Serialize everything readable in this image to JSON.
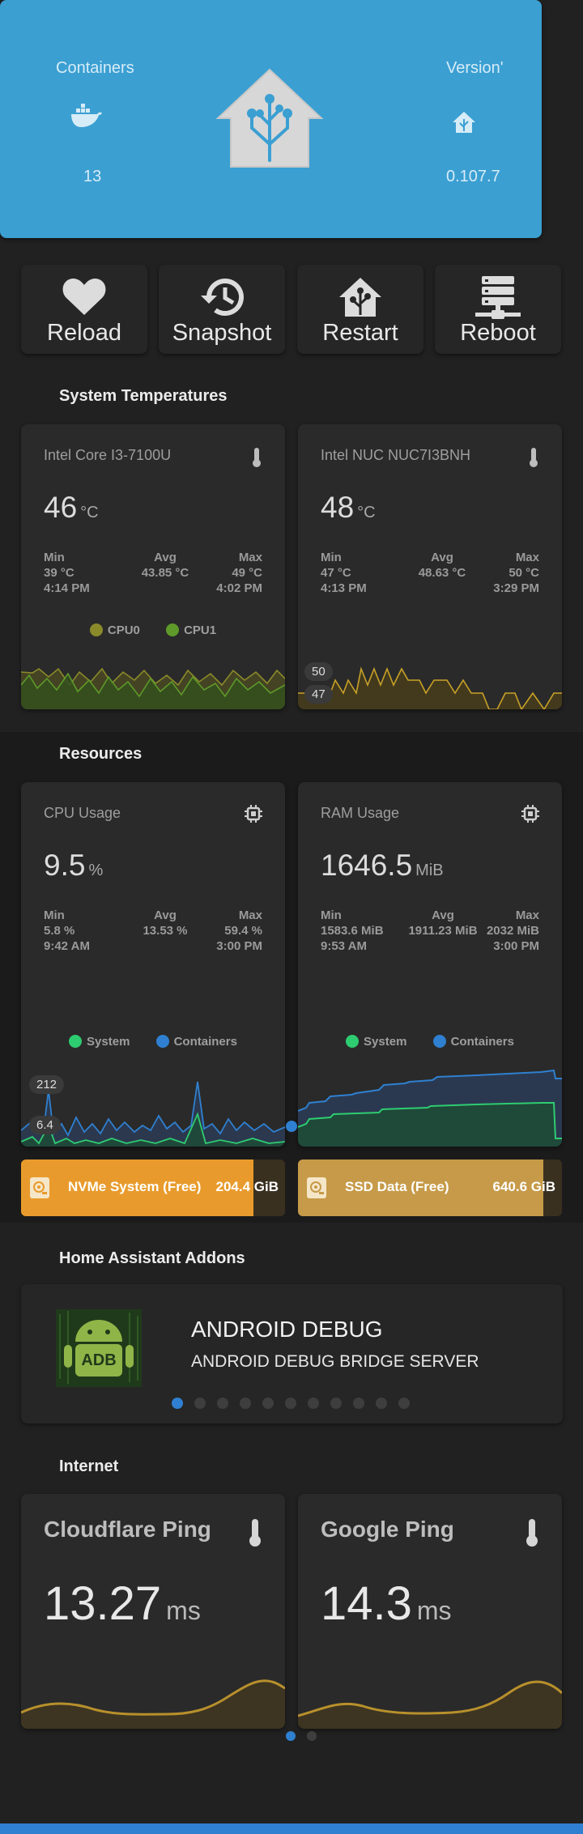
{
  "hero": {
    "containers_label": "Containers",
    "containers_value": "13",
    "version_label": "Version'",
    "version_value": "0.107.7",
    "hero_color": "#3b9fd2"
  },
  "buttons": [
    {
      "label": "Reload",
      "icon": "heart-icon"
    },
    {
      "label": "Snapshot",
      "icon": "restore-icon"
    },
    {
      "label": "Restart",
      "icon": "home-assistant-icon"
    },
    {
      "label": "Reboot",
      "icon": "server-network-icon"
    }
  ],
  "sections": {
    "temps": "System Temperatures",
    "resources": "Resources",
    "addons": "Home Assistant Addons",
    "internet": "Internet"
  },
  "temp_cards": [
    {
      "name": "Intel Core I3-7100U",
      "value": "46",
      "unit": "°C",
      "min_label": "Min",
      "avg_label": "Avg",
      "max_label": "Max",
      "min": "39 °C",
      "avg": "43.85 °C",
      "max": "49 °C",
      "min_time": "4:14 PM",
      "max_time": "4:02 PM",
      "legend": [
        "CPU0",
        "CPU1"
      ]
    },
    {
      "name": "Intel NUC NUC7I3BNH",
      "value": "48",
      "unit": "°C",
      "min_label": "Min",
      "avg_label": "Avg",
      "max_label": "Max",
      "min": "47 °C",
      "avg": "48.63 °C",
      "max": "50 °C",
      "min_time": "4:13 PM",
      "max_time": "3:29 PM",
      "chip_high": "50",
      "chip_low": "47"
    }
  ],
  "resource_cards": [
    {
      "name": "CPU Usage",
      "value": "9.5",
      "unit": "%",
      "min_label": "Min",
      "avg_label": "Avg",
      "max_label": "Max",
      "min": "5.8 %",
      "avg": "13.53 %",
      "max": "59.4 %",
      "min_time": "9:42 AM",
      "max_time": "3:00 PM",
      "legend": [
        "System",
        "Containers"
      ],
      "chip_high": "212",
      "chip_low": "6.4"
    },
    {
      "name": "RAM Usage",
      "value": "1646.5",
      "unit": "MiB",
      "min_label": "Min",
      "avg_label": "Avg",
      "max_label": "Max",
      "min": "1583.6 MiB",
      "avg": "1911.23 MiB",
      "max": "2032 MiB",
      "min_time": "9:53 AM",
      "max_time": "3:00 PM",
      "legend": [
        "System",
        "Containers"
      ]
    }
  ],
  "storage": [
    {
      "name": "NVMe System (Free)",
      "value": "204.4 GiB",
      "fill": 0.88,
      "color": "#e89b2c"
    },
    {
      "name": "SSD Data (Free)",
      "value": "640.6 GiB",
      "fill": 0.93,
      "color": "#c69a48"
    }
  ],
  "addon": {
    "title": "ANDROID DEBUG",
    "subtitle": "ANDROID DEBUG BRIDGE SERVER",
    "logo_text": "ADB",
    "page_count": 11,
    "active_page": 0
  },
  "ping_cards": [
    {
      "name": "Cloudflare Ping",
      "value": "13.27",
      "unit": "ms"
    },
    {
      "name": "Google Ping",
      "value": "14.3",
      "unit": "ms"
    }
  ],
  "ping_pages": {
    "count": 2,
    "active": 0
  },
  "colors": {
    "cpu0": "#8a8a2a",
    "cpu1": "#5e9a2a",
    "nuc_line": "#c9a227",
    "system": "#2ecc71",
    "containers": "#2f80d0",
    "ping_line": "#b8902c",
    "accent": "#3b9fd2"
  }
}
